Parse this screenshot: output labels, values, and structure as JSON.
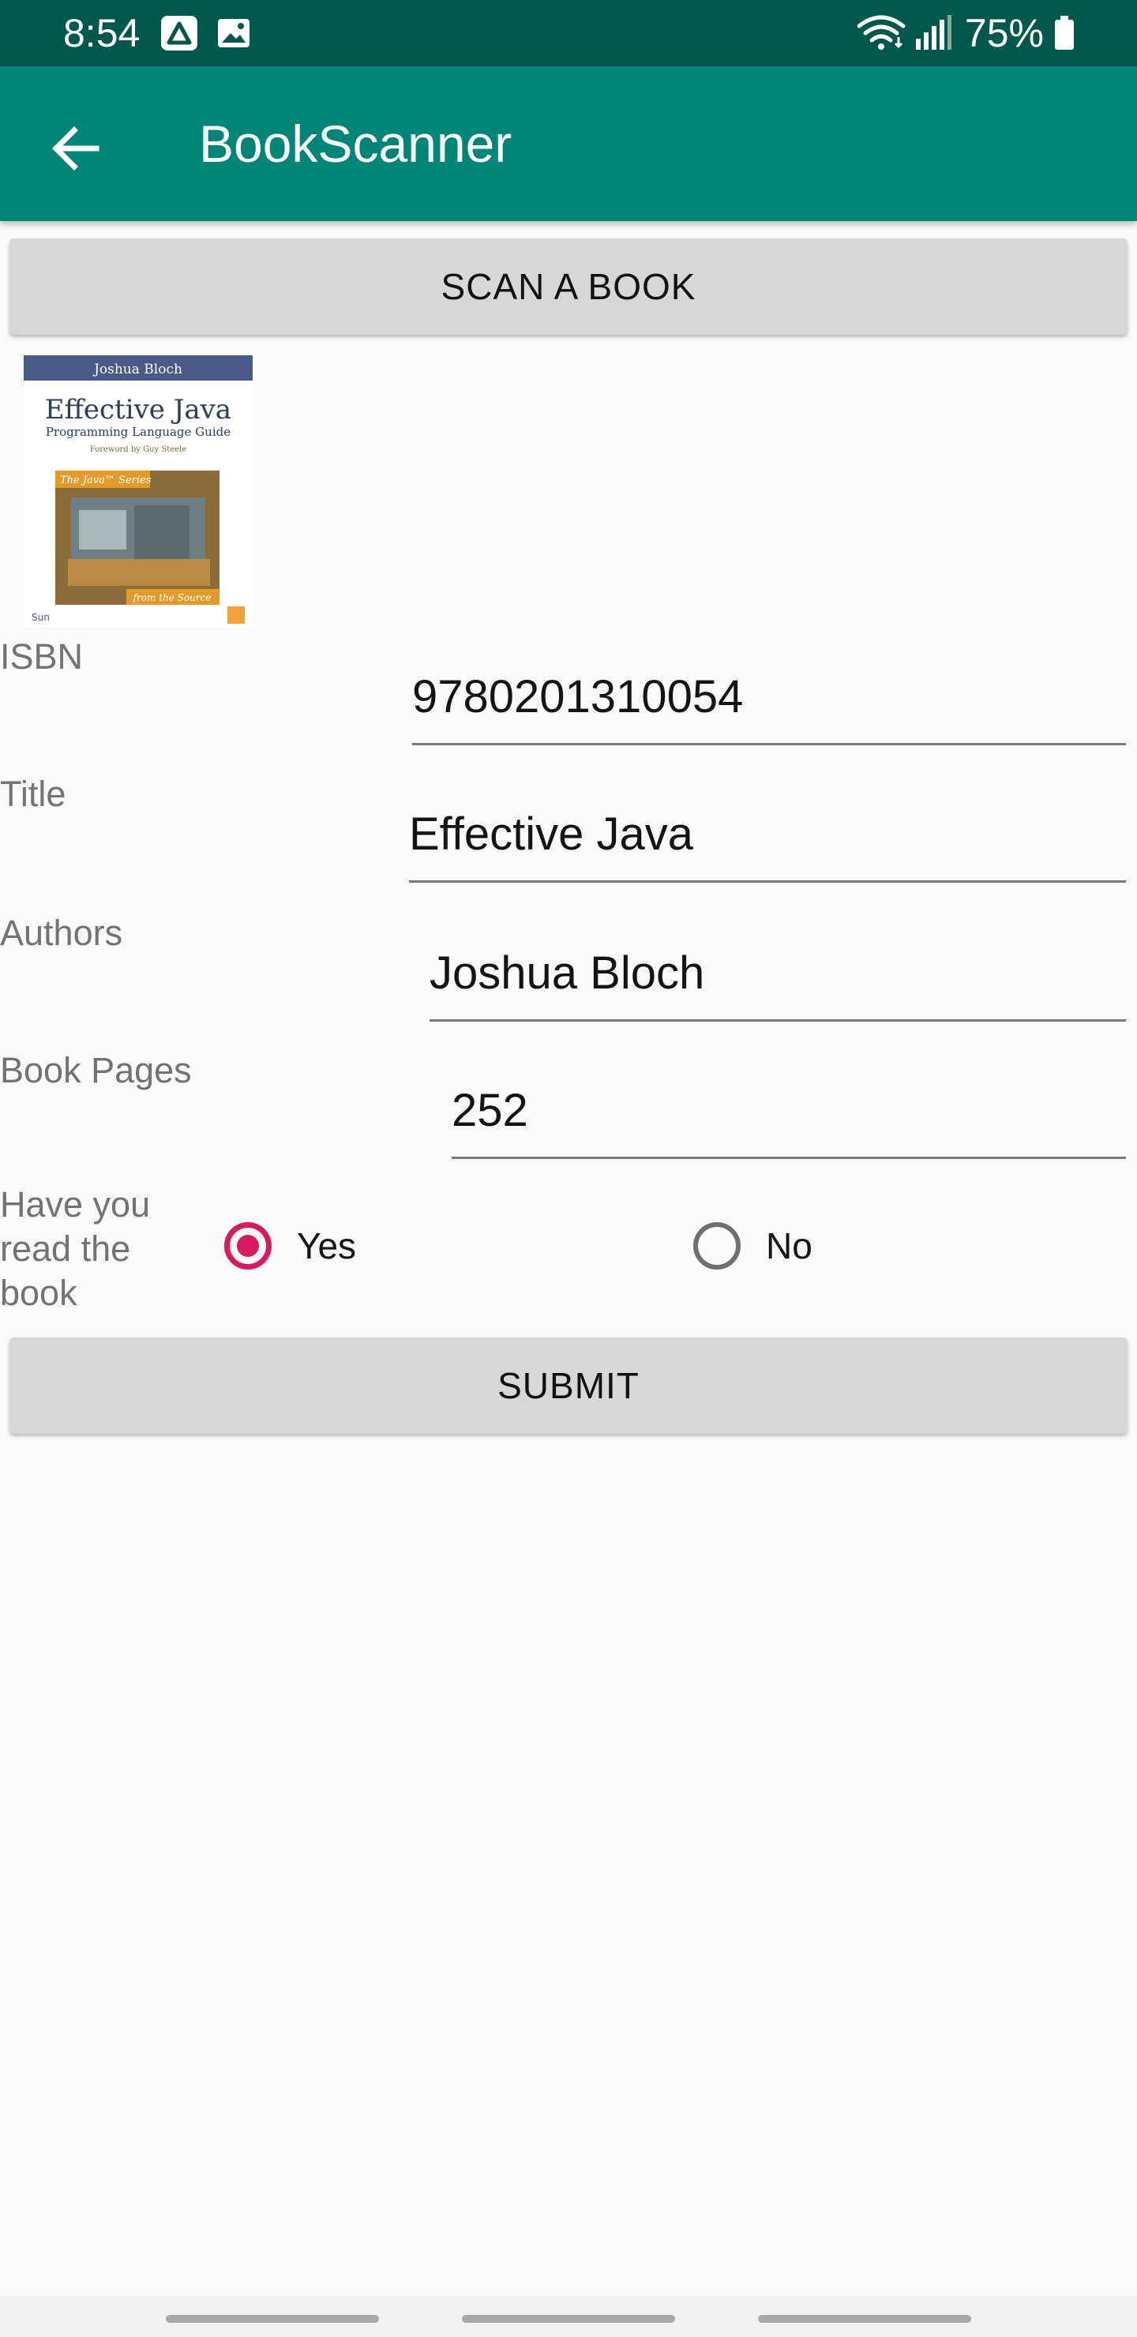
{
  "status_bar": {
    "time": "8:54",
    "battery_percent": "75%",
    "icons": [
      "notification-app-icon",
      "image-notification-icon",
      "wifi-icon",
      "signal-icon",
      "battery-icon"
    ]
  },
  "app_bar": {
    "title": "BookScanner",
    "back_icon": "arrow-left-icon"
  },
  "scan_button": {
    "label": "SCAN A BOOK"
  },
  "book_cover": {
    "author": "Joshua Bloch",
    "title": "Effective Java",
    "subtitle": "Programming Language Guide",
    "foreword": "Foreword by Guy Steele",
    "series": "The Java™ Series",
    "tagline": "from the Source",
    "publisher": "Sun"
  },
  "form": {
    "isbn": {
      "label": "ISBN",
      "value": "9780201310054"
    },
    "title": {
      "label": "Title",
      "value": "Effective Java"
    },
    "authors": {
      "label": "Authors",
      "value": "Joshua Bloch"
    },
    "pages": {
      "label": "Book Pages",
      "value": "252"
    },
    "read_question": "Have you read the book",
    "options": {
      "yes": "Yes",
      "no": "No"
    },
    "selected": "Yes"
  },
  "submit_button": {
    "label": "SUBMIT"
  },
  "colors": {
    "status_bar": "#00574b",
    "app_bar": "#008577",
    "accent": "#d81b60",
    "button": "#d6d7d7"
  }
}
